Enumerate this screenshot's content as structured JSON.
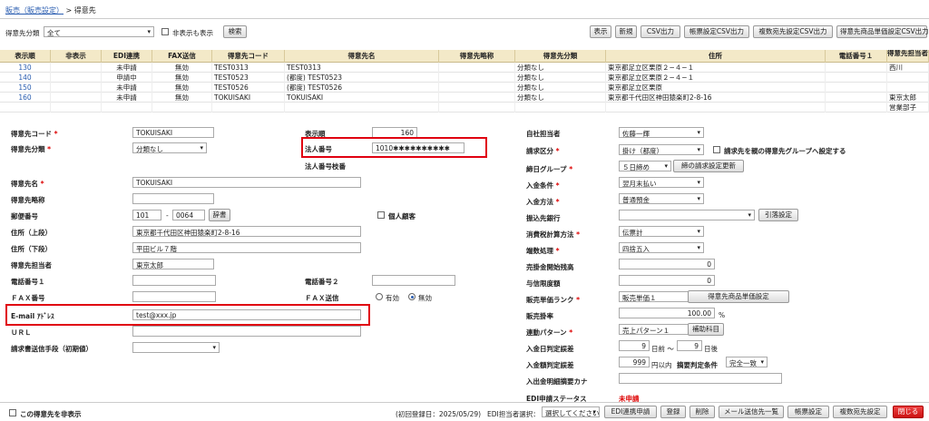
{
  "breadcrumb": {
    "parent": "販売（販売設定）",
    "sep": ">",
    "current": "得意先"
  },
  "filter": {
    "label": "得意先分類",
    "value": "全て",
    "show_hidden": "非表示も表示",
    "search": "検索"
  },
  "toolbar": {
    "display": "表示",
    "new": "新規",
    "csv": "CSV出力",
    "form_csv": "帳票設定CSV出力",
    "multi_csv": "複数宛先設定CSV出力",
    "price_csv": "得意先商品単価設定CSV出力"
  },
  "grid": {
    "columns": [
      "表示順",
      "非表示",
      "EDI連携",
      "FAX送信",
      "得意先コード",
      "得意先名",
      "得意先略称",
      "得意先分類",
      "住所",
      "電話番号１",
      "得意先担当者"
    ],
    "rows": [
      [
        "130",
        "",
        "未申請",
        "無効",
        "TEST0313",
        "TEST0313",
        "",
        "分類なし",
        "東京都足立区栗原２−４−１",
        "",
        "西川"
      ],
      [
        "140",
        "",
        "申請中",
        "無効",
        "TEST0523",
        "(都度) TEST0523",
        "",
        "分類なし",
        "東京都足立区栗原２−４−１",
        "",
        ""
      ],
      [
        "150",
        "",
        "未申請",
        "無効",
        "TEST0526",
        "(都度) TEST0526",
        "",
        "分類なし",
        "東京都足立区栗原",
        "",
        ""
      ],
      [
        "160",
        "",
        "未申請",
        "無効",
        "TOKUISAKI",
        "TOKUISAKI",
        "",
        "分類なし",
        "東京都千代田区神田猿楽町2-8-16",
        "",
        "東京太郎"
      ],
      [
        "",
        "",
        "",
        "",
        "",
        "",
        "",
        "",
        "",
        "",
        "営業部子"
      ]
    ]
  },
  "form": {
    "code_label": "得意先コード",
    "code": "TOKUISAKI",
    "cat_label": "得意先分類",
    "cat": "分類なし",
    "order_label": "表示順",
    "order": "160",
    "corp_label": "法人番号",
    "corp": "1010✱✱✱✱✱✱✱✱✱✱",
    "corp_branch_label": "法人番号枝番",
    "name_label": "得意先名",
    "name": "TOKUISAKI",
    "short_label": "得意先略称",
    "zip_label": "郵便番号",
    "zip1": "101",
    "zip_dash": "-",
    "zip2": "0064",
    "dict": "辞書",
    "individual": "個人顧客",
    "addr1_label": "住所（上段）",
    "addr1": "東京都千代田区神田猿楽町2-8-16",
    "addr2_label": "住所（下段）",
    "addr2": "平田ビル７階",
    "person_label": "得意先担当者",
    "person": "東京太郎",
    "tel1_label": "電話番号１",
    "tel2_label": "電話番号２",
    "fax_label": "ＦＡＸ番号",
    "faxsend_label": "ＦＡＸ送信",
    "fax_on": "有効",
    "fax_off": "無効",
    "email_label": "E-mail ｱﾄﾞﾚｽ",
    "email": "test@xxx.jp",
    "url_label": "ＵＲＬ",
    "invoice_label": "請求書送信手段（初期値）",
    "staff_label": "自社担当者",
    "staff": "佐藤一輝",
    "billing_label": "請求区分",
    "billing": "掛け（都度）",
    "parent_group": "請求先を親の得意先グループへ設定する",
    "close_label": "締日グループ",
    "close": "５日締め",
    "close_btn": "締の請求設定更新",
    "pay_cond_label": "入金条件",
    "pay_cond": "翌月末払い",
    "pay_method_label": "入金方法",
    "pay_method": "普通預金",
    "bank_label": "振込先銀行",
    "bank_btn": "引落設定",
    "tax_calc_label": "消費税計算方法",
    "tax_calc": "伝票計",
    "rounding_label": "端数処理",
    "rounding": "四捨五入",
    "ar_label": "売掛金開始残高",
    "ar": "0",
    "credit_label": "与信限度額",
    "credit": "0",
    "rank_label": "販売単価ランク",
    "rank": "販売単価１",
    "rank_btn": "得意先商品単価設定",
    "rate_label": "販売掛率",
    "rate": "100.00",
    "rate_unit": "%",
    "pattern_label": "連動パターン",
    "pattern": "売上パターン１",
    "pattern_btn": "補助科目",
    "date_range_label": "入金日判定誤差",
    "date_before": "9",
    "date_before_unit": "日前 〜",
    "date_after": "9",
    "date_after_unit": "日後",
    "amount_label": "入金額判定誤差",
    "amount": "999",
    "amount_unit": "円以内",
    "summary_label": "摘要判定条件",
    "summary": "完全一致",
    "kana_label": "入出金明細摘要カナ",
    "edi_label": "EDI申請ステータス",
    "edi_status": "未申請"
  },
  "footer": {
    "hide": "この得意先を非表示",
    "reg_date": "(初回登録日：2025/05/29)",
    "edi_person_label": "EDI担当者選択：",
    "edi_person": "選択してください",
    "edi_apply": "EDI連携申請",
    "register": "登録",
    "delete": "削除",
    "mail_list": "メール送信先一覧",
    "form_set": "帳票設定",
    "multi_set": "複数宛先設定",
    "close": "閉じる"
  },
  "colors": {
    "required": "#dd0000",
    "highlight": "#e00010",
    "header": "#f3e9c8",
    "link": "#2a5db0"
  }
}
